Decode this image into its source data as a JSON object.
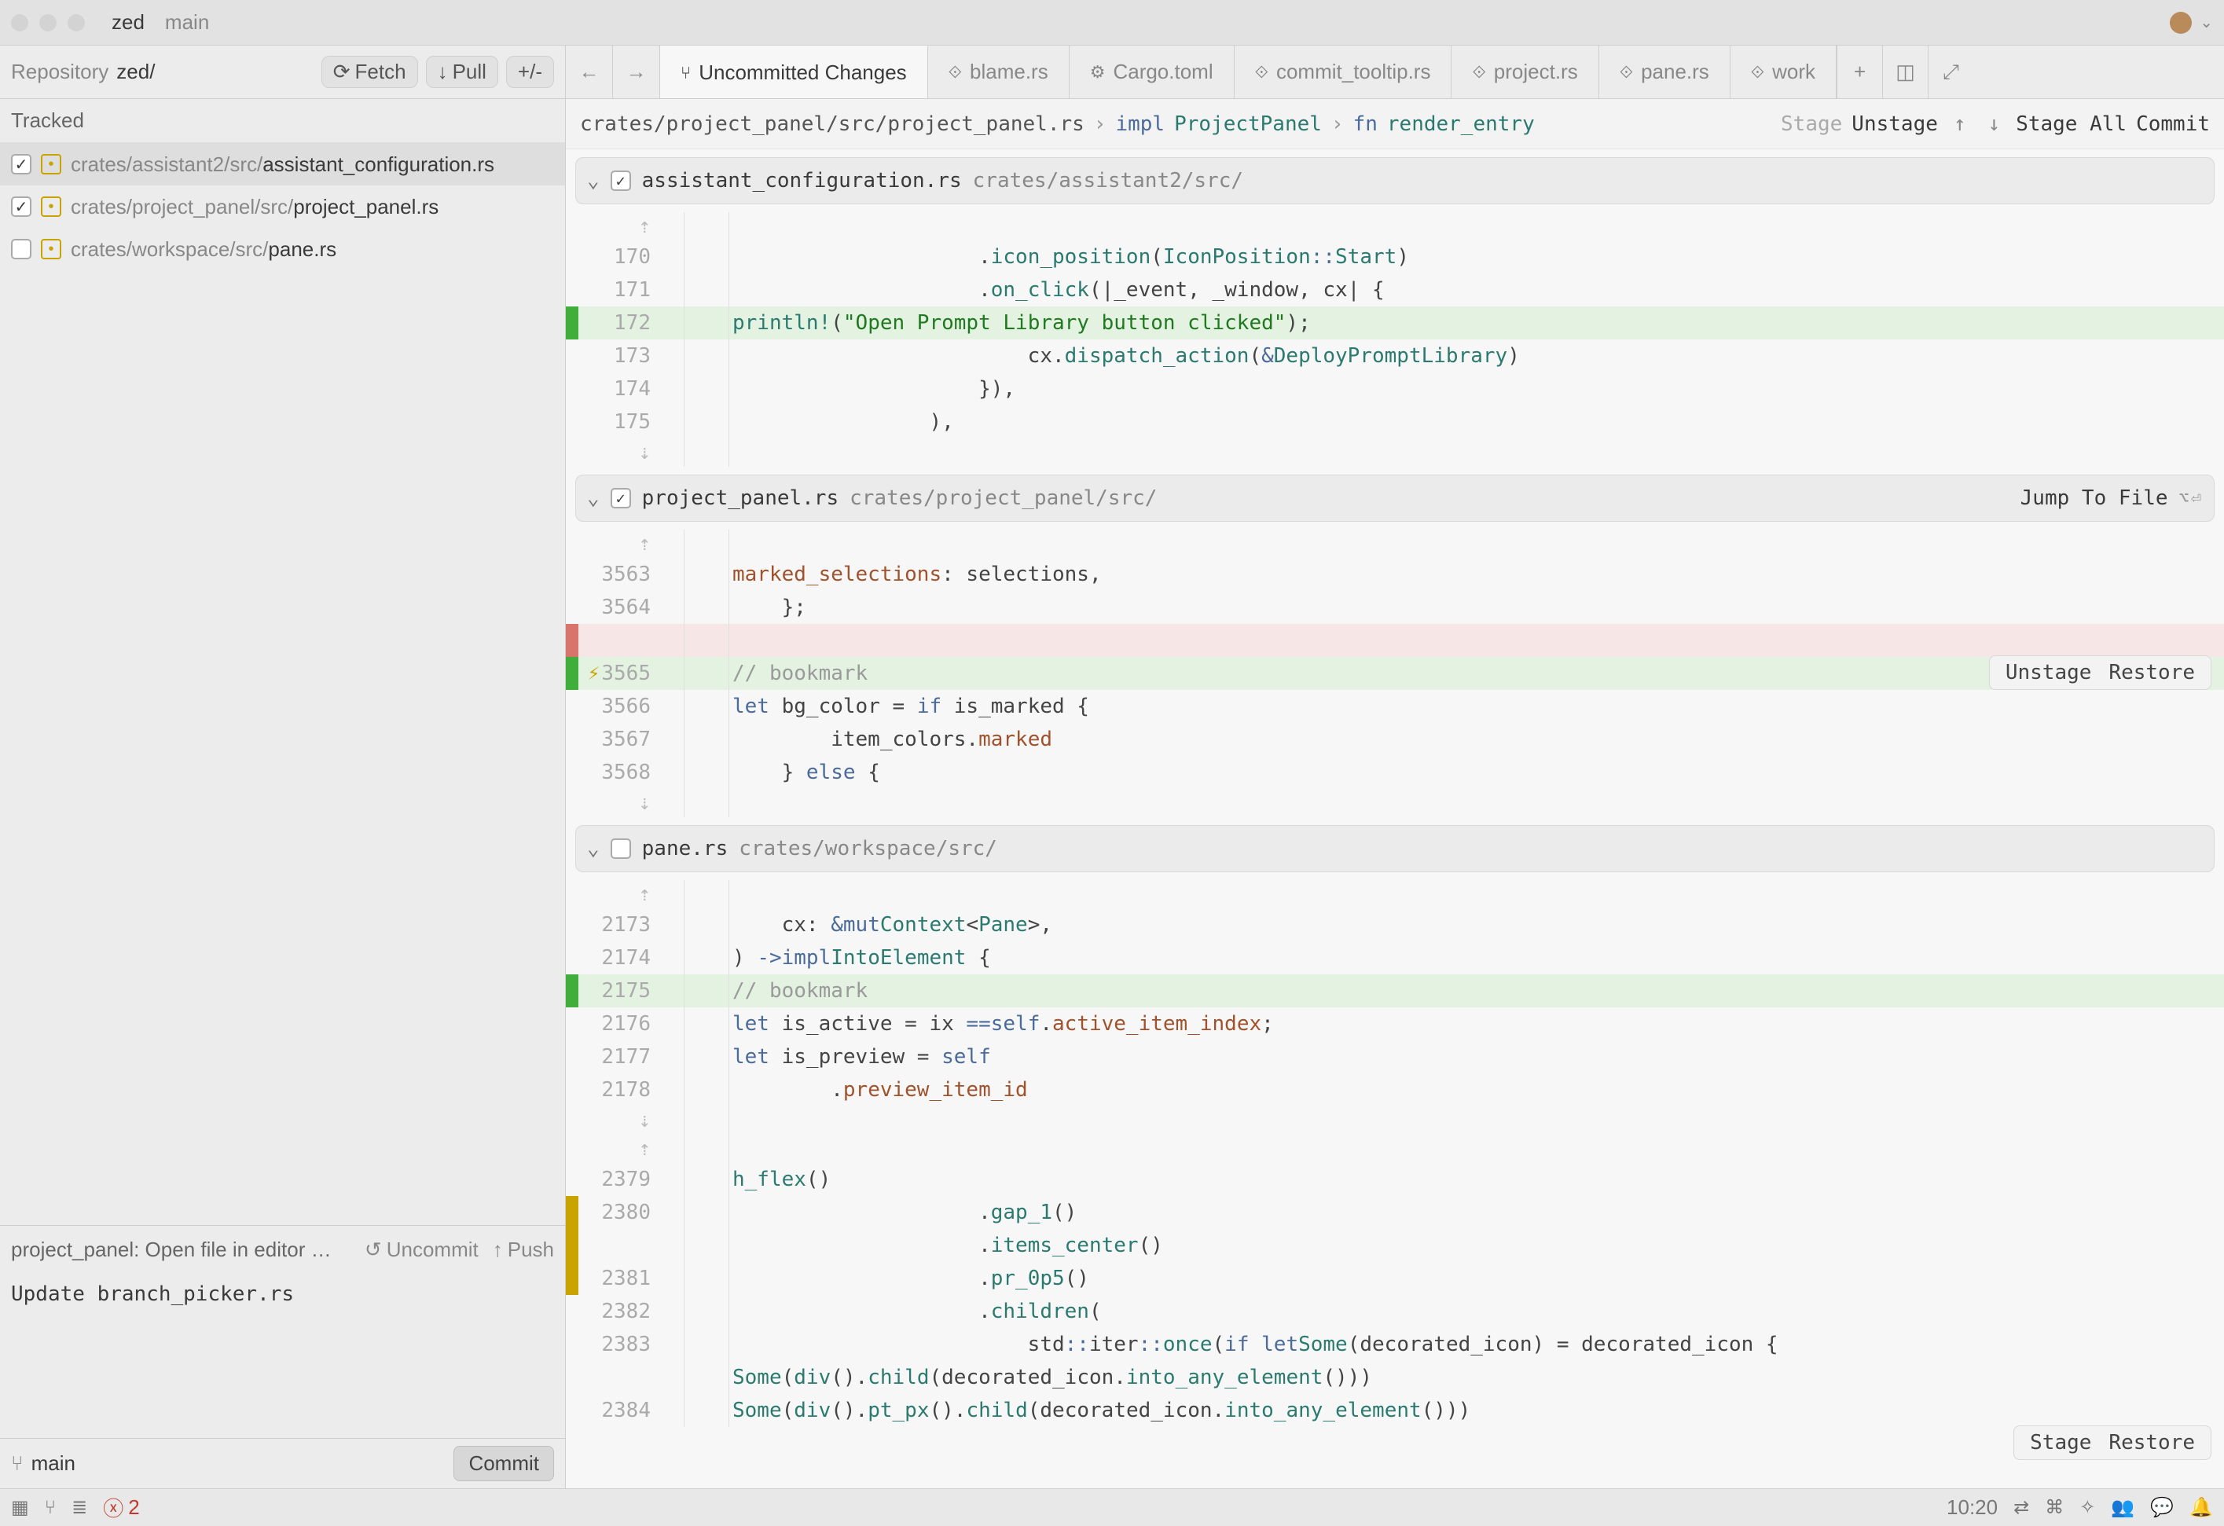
{
  "title": {
    "project": "zed",
    "branch": "main"
  },
  "repo": {
    "label": "Repository",
    "name": "zed/",
    "fetch": "Fetch",
    "pull": "Pull",
    "pm": "+/-"
  },
  "sidebar": {
    "tracked": "Tracked",
    "files": [
      {
        "checked": true,
        "dir": "crates/assistant2/src/",
        "name": "assistant_configuration.rs"
      },
      {
        "checked": true,
        "dir": "crates/project_panel/src/",
        "name": "project_panel.rs"
      },
      {
        "checked": false,
        "dir": "crates/workspace/src/",
        "name": "pane.rs"
      }
    ]
  },
  "commit": {
    "headline": "project_panel: Open file in editor …",
    "uncommit": "Uncommit",
    "push": "Push",
    "message": "Update branch_picker.rs",
    "branch": "main",
    "button": "Commit"
  },
  "tabs": {
    "items": [
      {
        "label": "Uncommitted Changes",
        "icon": "branch"
      },
      {
        "label": "blame.rs",
        "icon": "rs"
      },
      {
        "label": "Cargo.toml",
        "icon": "toml"
      },
      {
        "label": "commit_tooltip.rs",
        "icon": "rs"
      },
      {
        "label": "project.rs",
        "icon": "rs"
      },
      {
        "label": "pane.rs",
        "icon": "rs"
      },
      {
        "label": "work",
        "icon": "rs"
      }
    ]
  },
  "crumbs": {
    "path": "crates/project_panel/src/project_panel.rs",
    "impl": "impl",
    "type": "ProjectPanel",
    "fn": "fn",
    "name": "render_entry",
    "stage": "Stage",
    "unstage": "Unstage",
    "stage_all": "Stage All",
    "commit": "Commit"
  },
  "files": [
    {
      "name": "assistant_configuration.rs",
      "path": "crates/assistant2/src/",
      "checked": true,
      "lines": [
        {
          "n": "170",
          "html": "                    .<span class='c-fn'>icon_position</span>(<span class='c-ty'>IconPosition</span><span class='c-op'>::</span><span class='c-ty'>Start</span>)"
        },
        {
          "n": "171",
          "html": "                    .<span class='c-fn'>on_click</span>(|_event, _window, cx| {"
        },
        {
          "n": "172",
          "cls": "add",
          "html": "                        <span class='c-fn'>println!</span>(<span class='c-str'>\"Open Prompt Library button clicked\"</span>);"
        },
        {
          "n": "173",
          "html": "                        cx.<span class='c-fn'>dispatch_action</span>(<span class='c-op'>&</span><span class='c-ty'>DeployPromptLibrary</span>)"
        },
        {
          "n": "174",
          "html": "                    }),"
        },
        {
          "n": "175",
          "html": "                ),"
        }
      ]
    },
    {
      "name": "project_panel.rs",
      "path": "crates/project_panel/src/",
      "checked": true,
      "jump": "Jump To File",
      "lines1": [
        {
          "n": "3563",
          "html": "        <span class='c-prop'>marked_selections</span>: selections,"
        },
        {
          "n": "3564",
          "html": "    };"
        }
      ],
      "actions": {
        "unstage": "Unstage",
        "restore": "Restore"
      },
      "lines2": [
        {
          "n": "3565",
          "cls": "add bolt",
          "html": "    <span class='c-cm'>// bookmark</span>"
        },
        {
          "n": "3566",
          "html": "    <span class='c-kw'>let</span> bg_color = <span class='c-kw'>if</span> is_marked {"
        },
        {
          "n": "3567",
          "html": "        item_colors.<span class='c-prop'>marked</span>"
        },
        {
          "n": "3568",
          "html": "    } <span class='c-kw'>else</span> {"
        }
      ]
    },
    {
      "name": "pane.rs",
      "path": "crates/workspace/src/",
      "checked": false,
      "lines1": [
        {
          "n": "2173",
          "html": "    cx: <span class='c-op'>&mut</span> <span class='c-ty'>Context</span>&lt;<span class='c-ty'>Pane</span>&gt;,"
        },
        {
          "n": "2174",
          "html": ") <span class='c-op'>-&gt;</span> <span class='c-kw'>impl</span> <span class='c-ty'>IntoElement</span> {"
        },
        {
          "n": "2175",
          "cls": "add",
          "html": "    <span class='c-cm'>// bookmark</span>"
        },
        {
          "n": "2176",
          "html": "    <span class='c-kw'>let</span> is_active = ix <span class='c-op'>==</span> <span class='c-kw'>self</span>.<span class='c-prop'>active_item_index</span>;"
        },
        {
          "n": "2177",
          "html": "    <span class='c-kw'>let</span> is_preview = <span class='c-kw'>self</span>"
        },
        {
          "n": "2178",
          "html": "        .<span class='c-prop'>preview_item_id</span>"
        }
      ],
      "lines2": [
        {
          "n": "2379",
          "html": "                <span class='c-fn'>h_flex</span>()"
        },
        {
          "n": "2380",
          "cls": "y",
          "html": "                    .<span class='c-fn'>gap_1</span>()\n                    .<span class='c-fn'>items_center</span>()",
          "multi": true
        },
        {
          "n": "2381",
          "cls": "y",
          "html": "                    .<span class='c-fn'>pr_0p5</span>()"
        },
        {
          "n": "2382",
          "html": "                    .<span class='c-fn'>children</span>("
        },
        {
          "n": "2383",
          "html": "                        std<span class='c-op'>::</span>iter<span class='c-op'>::</span><span class='c-fn'>once</span>(<span class='c-kw'>if let</span> <span class='c-ty'>Some</span>(decorated_icon) = decorated_icon {"
        },
        {
          "n": "",
          "html": "                            <span class='c-ty'>Some</span>(<span class='c-fn'>div</span>().<span class='c-fn'>child</span>(decorated_icon.<span class='c-fn'>into_any_element</span>()))"
        },
        {
          "n": "2384",
          "html": "                            <span class='c-ty'>Some</span>(<span class='c-fn'>div</span>().<span class='c-fn'>pt_px</span>().<span class='c-fn'>child</span>(decorated_icon.<span class='c-fn'>into_any_element</span>()))"
        }
      ],
      "actions": {
        "stage": "Stage",
        "restore": "Restore"
      }
    }
  ],
  "status": {
    "errors": "2",
    "time": "10:20"
  }
}
